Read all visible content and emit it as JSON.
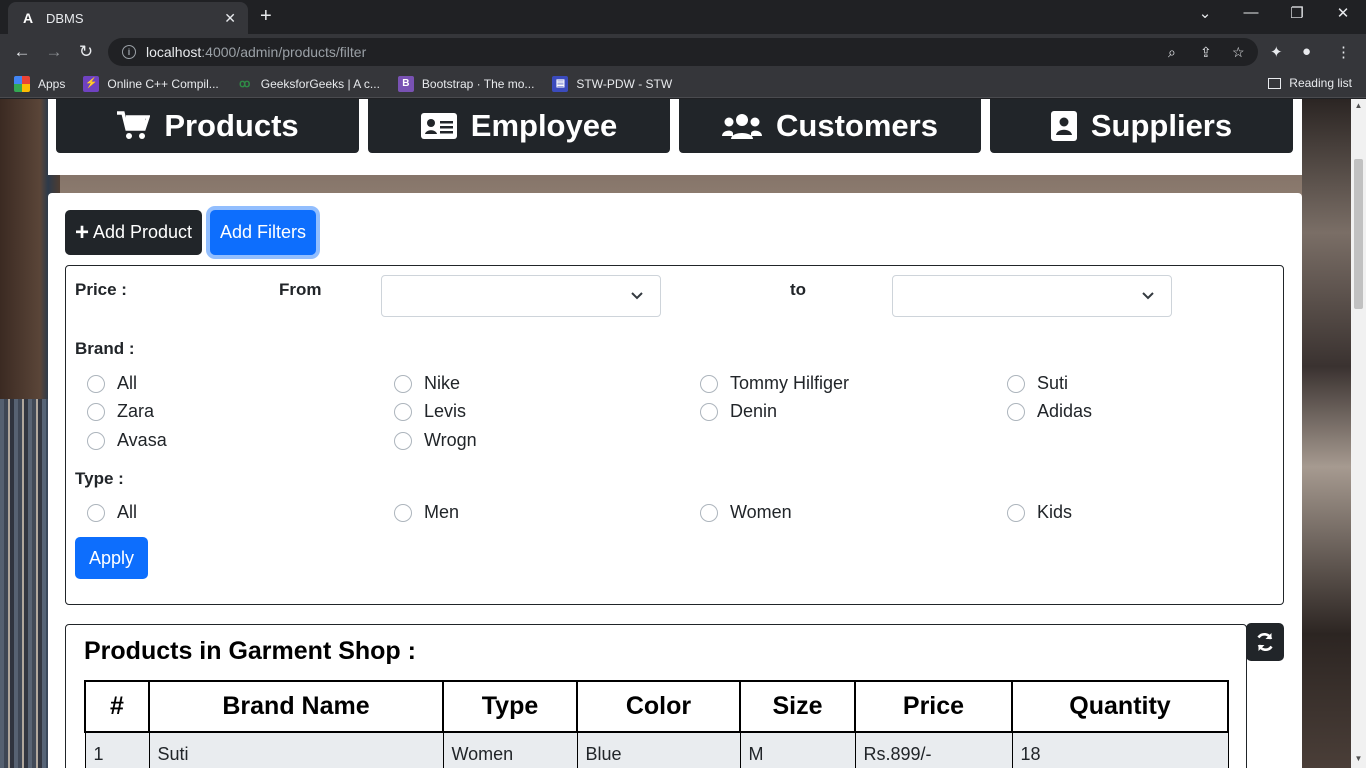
{
  "browser": {
    "tab_title": "DBMS",
    "tab_favicon": "A",
    "url_host": "localhost",
    "url_rest": ":4000/admin/products/filter",
    "bookmarks": [
      {
        "label": "Apps",
        "icon": "apps-grid-icon"
      },
      {
        "label": "Online C++ Compil...",
        "icon": "lightning-icon"
      },
      {
        "label": "GeeksforGeeks | A c...",
        "icon": "gfg-icon"
      },
      {
        "label": "Bootstrap · The mo...",
        "icon": "bootstrap-icon"
      },
      {
        "label": "STW-PDW - STW",
        "icon": "stw-icon"
      }
    ],
    "reading_list": "Reading list"
  },
  "nav": {
    "products": "Products",
    "employee": "Employee",
    "customers": "Customers",
    "suppliers": "Suppliers"
  },
  "actions": {
    "add_product": "Add Product",
    "add_filters": "Add Filters"
  },
  "filters": {
    "price_label": "Price :",
    "from_label": "From",
    "to_label": "to",
    "from_value": "",
    "to_value": "",
    "brand_label": "Brand :",
    "brands": [
      "All",
      "Nike",
      "Tommy Hilfiger",
      "Suti",
      "Zara",
      "Levis",
      "Denin",
      "Adidas",
      "Avasa",
      "Wrogn"
    ],
    "type_label": "Type :",
    "types": [
      "All",
      "Men",
      "Women",
      "Kids"
    ],
    "apply": "Apply"
  },
  "products_table": {
    "title": "Products in Garment Shop :",
    "headers": [
      "#",
      "Brand Name",
      "Type",
      "Color",
      "Size",
      "Price",
      "Quantity"
    ],
    "rows": [
      [
        "1",
        "Suti",
        "Women",
        "Blue",
        "M",
        "Rs.899/-",
        "18"
      ]
    ]
  },
  "colors": {
    "primary": "#0d6efd",
    "dark": "#212529"
  }
}
